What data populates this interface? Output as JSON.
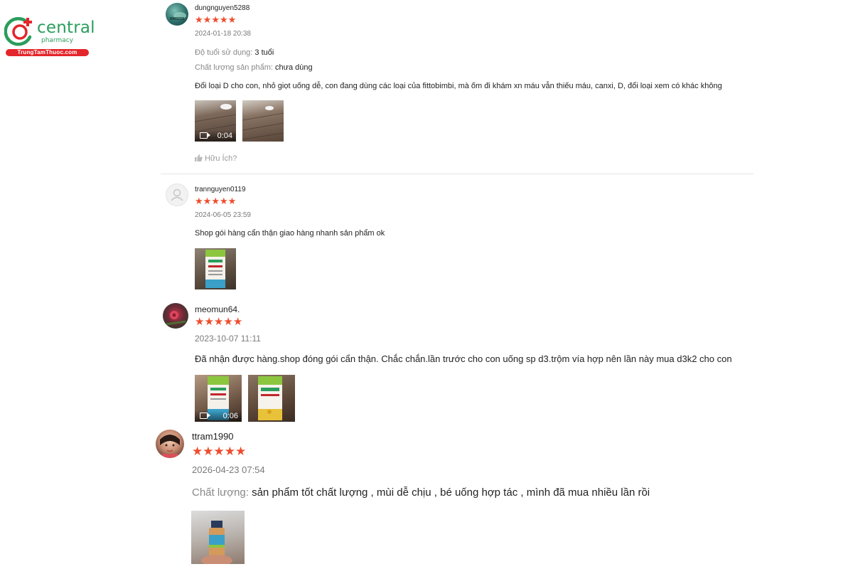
{
  "brand": {
    "name": "central",
    "sub": "pharmacy",
    "site": "TrungTamThuoc.com",
    "green": "#2a9d5c",
    "red": "#e3262b"
  },
  "star_glyph": "★",
  "star_color": "#ee4d2d",
  "reviews": [
    {
      "username": "dungnguyen5288",
      "rating": 5,
      "date": "2024-01-18 20:38",
      "age_label": "Độ tuổi sử dụng:",
      "age_value": "3 tuổi",
      "quality_label": "Chất lượng sản phẩm:",
      "quality_value": "chưa dùng",
      "content": "Đổi loại D cho con, nhỏ giọt uống dễ, con đang dùng các loại của fittobimbi, mà ốm đi khám xn máu vẫn thiếu máu, canxi, D, đổi loại xem có khác không",
      "media": [
        {
          "type": "video",
          "duration": "0:04"
        },
        {
          "type": "image"
        }
      ],
      "helpful": "Hữu Ích?"
    },
    {
      "username": "trannguyen0119",
      "rating": 5,
      "date": "2024-06-05 23:59",
      "content": "Shop gói hàng cẩn thận giao hàng nhanh sản phẩm ok",
      "media": [
        {
          "type": "image"
        }
      ]
    },
    {
      "username": "meomun64.",
      "rating": 5,
      "date": "2023-10-07 11:11",
      "content": "Đã nhận được hàng.shop đóng gói cẩn thận. Chắc chắn.lần trước cho con uống sp d3.trộm vía hợp nên lần này mua d3k2 cho con",
      "media": [
        {
          "type": "video",
          "duration": "0:06"
        },
        {
          "type": "image"
        }
      ]
    },
    {
      "username": "ttram1990",
      "rating": 5,
      "date": "2026-04-23 07:54",
      "quality_label": "Chất lượng:",
      "content": "sản phẩm tốt chất lượng , mùi dễ chịu , bé uống hợp tác , mình đã mua nhiều lần rồi",
      "media": [
        {
          "type": "image"
        }
      ]
    }
  ]
}
